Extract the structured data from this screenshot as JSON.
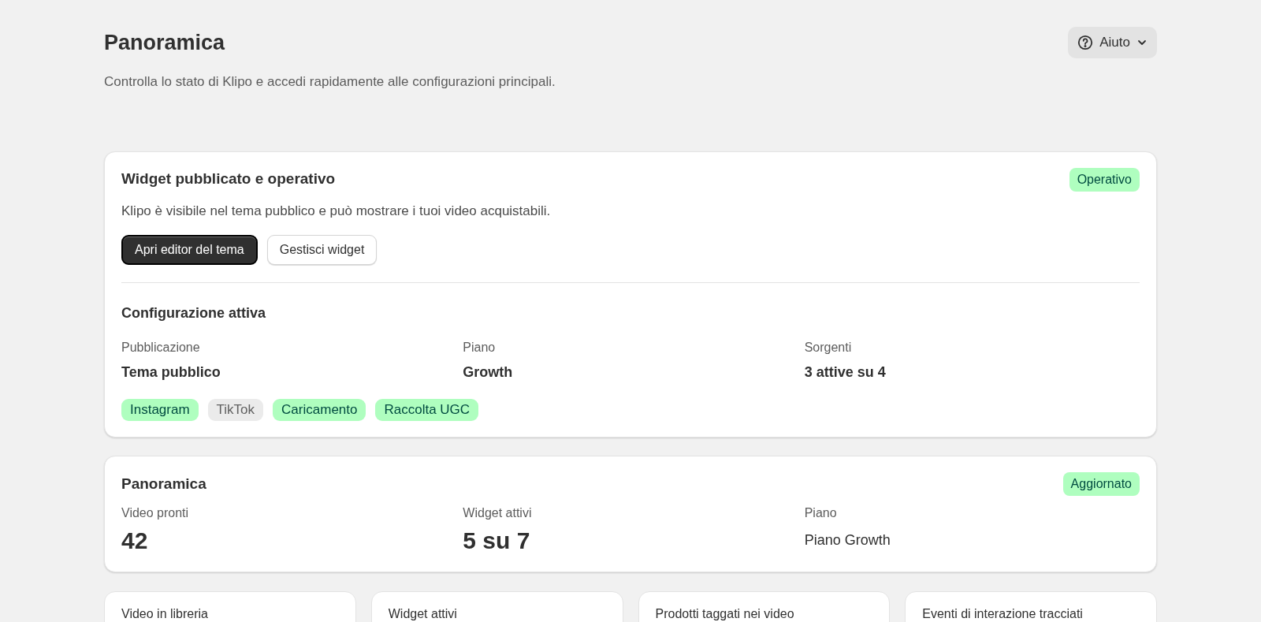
{
  "page": {
    "title": "Panoramica",
    "subtitle": "Controlla lo stato di Klipo e accedi rapidamente alle configurazioni principali.",
    "help_button": "Aiuto"
  },
  "widget_card": {
    "title": "Widget pubblicato e operativo",
    "badge": "Operativo",
    "description": "Klipo è visibile nel tema pubblico e può mostrare i tuoi video acquistabili.",
    "buttons": [
      {
        "label": "Apri editor del tema",
        "kind": "primary"
      },
      {
        "label": "Gestisci widget",
        "kind": "secondary"
      }
    ],
    "section_title": "Configurazione attiva",
    "fields": [
      {
        "label": "Pubblicazione",
        "value": "Tema pubblico"
      },
      {
        "label": "Piano",
        "value": "Growth"
      },
      {
        "label": "Sorgenti",
        "value": "3 attive su 4"
      }
    ],
    "sources": [
      {
        "label": "Instagram",
        "on": true
      },
      {
        "label": "TikTok",
        "on": false
      },
      {
        "label": "Caricamento",
        "on": true
      },
      {
        "label": "Raccolta UGC",
        "on": true
      }
    ]
  },
  "overview_card": {
    "title": "Panoramica",
    "badge": "Aggiornato",
    "metrics": [
      {
        "label": "Video pronti",
        "value": "42",
        "kind": "number"
      },
      {
        "label": "Widget attivi",
        "value": "5 su 7",
        "kind": "number"
      },
      {
        "label": "Piano",
        "value": "Piano Growth",
        "kind": "text"
      }
    ]
  },
  "stat_cards": [
    {
      "label": "Video in libreria"
    },
    {
      "label": "Widget attivi"
    },
    {
      "label": "Prodotti taggati nei video"
    },
    {
      "label": "Eventi di interazione tracciati"
    }
  ]
}
